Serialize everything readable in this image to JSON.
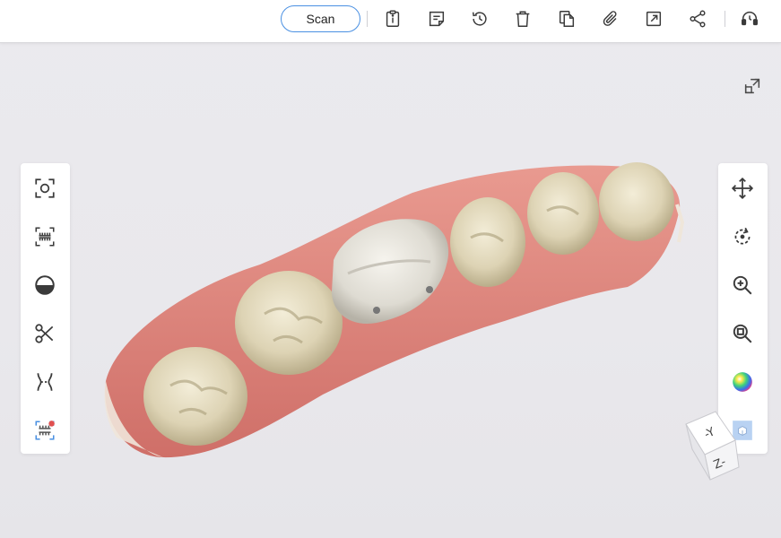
{
  "toolbar": {
    "scan_label": "Scan",
    "icons": [
      "clipboard-info-icon",
      "note-icon",
      "history-icon",
      "trash-icon",
      "copy-icon",
      "attachment-icon",
      "export-icon",
      "share-icon",
      "headset-icon"
    ]
  },
  "left_tools": [
    "scan-view-icon",
    "arch-view-icon",
    "half-circle-icon",
    "scissors-icon",
    "trim-margin-icon",
    "bite-scan-icon"
  ],
  "right_tools": [
    "move-icon",
    "rotate-icon",
    "zoom-in-icon",
    "zoom-fit-icon",
    "color-map-icon",
    "view-cube-icon"
  ],
  "axis_cube": {
    "label_y": "-Y",
    "label_z": "Z-"
  },
  "colors": {
    "accent": "#4a90e2",
    "gum": "#e38b84",
    "tooth": "#e4dcc2",
    "icon": "#3a3a3a"
  }
}
